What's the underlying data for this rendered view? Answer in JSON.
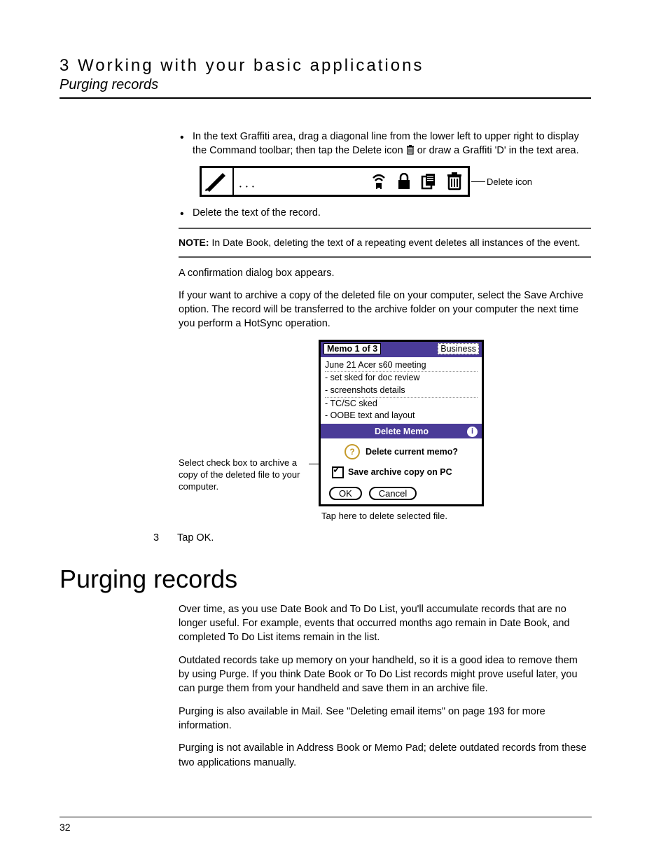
{
  "header": {
    "chapter": "3 Working with your basic applications",
    "section": "Purging records"
  },
  "bullet1": "In the text Graffiti area, drag a diagonal line from the lower left to upper right to display the Command toolbar; then tap the Delete icon ",
  "bullet1_tail": " or draw a Graffiti 'D' in the text area.",
  "toolbar_label": "Delete icon",
  "bullet2": "Delete the text of the record.",
  "note_label": "NOTE:",
  "note_text": "In Date Book, deleting the text of a repeating event deletes all instances of the event.",
  "para1": "A confirmation dialog box appears.",
  "para2": "If your want to archive a copy of the deleted file on your computer, select the Save Archive option. The record will be transferred to the archive folder on your computer the next time you perform a HotSync operation.",
  "fig_left": "Select check box to archive a copy of the deleted file to your computer.",
  "palm": {
    "title": "Memo 1 of 3",
    "category": "Business",
    "lines": [
      "June 21 Acer s60 meeting",
      "- set sked for doc review",
      "- screenshots details",
      "- TC/SC sked",
      "- OOBE text and layout"
    ],
    "dialog_title": "Delete Memo",
    "dialog_q": "Delete current memo?",
    "checkbox": "Save archive copy on PC",
    "ok": "OK",
    "cancel": "Cancel"
  },
  "fig_bottom": "Tap here to delete selected file.",
  "step": {
    "num": "3",
    "text": "Tap OK."
  },
  "section_heading": "Purging records",
  "p_para1": "Over time, as you use Date Book and To Do List, you'll accumulate records that are no longer useful. For example, events that occurred months ago remain in Date Book, and completed To Do List items remain in the list.",
  "p_para2": "Outdated records take up memory on your handheld, so it is a good idea to remove them by using Purge. If you think Date Book or To Do List records might prove useful later, you can purge them from your handheld and save them in an archive file.",
  "p_para3": "Purging is also available in Mail. See \"Deleting email items\" on page 193 for more information.",
  "p_para4": "Purging is not available in Address Book or Memo Pad; delete outdated records from these two applications manually.",
  "page_number": "32"
}
